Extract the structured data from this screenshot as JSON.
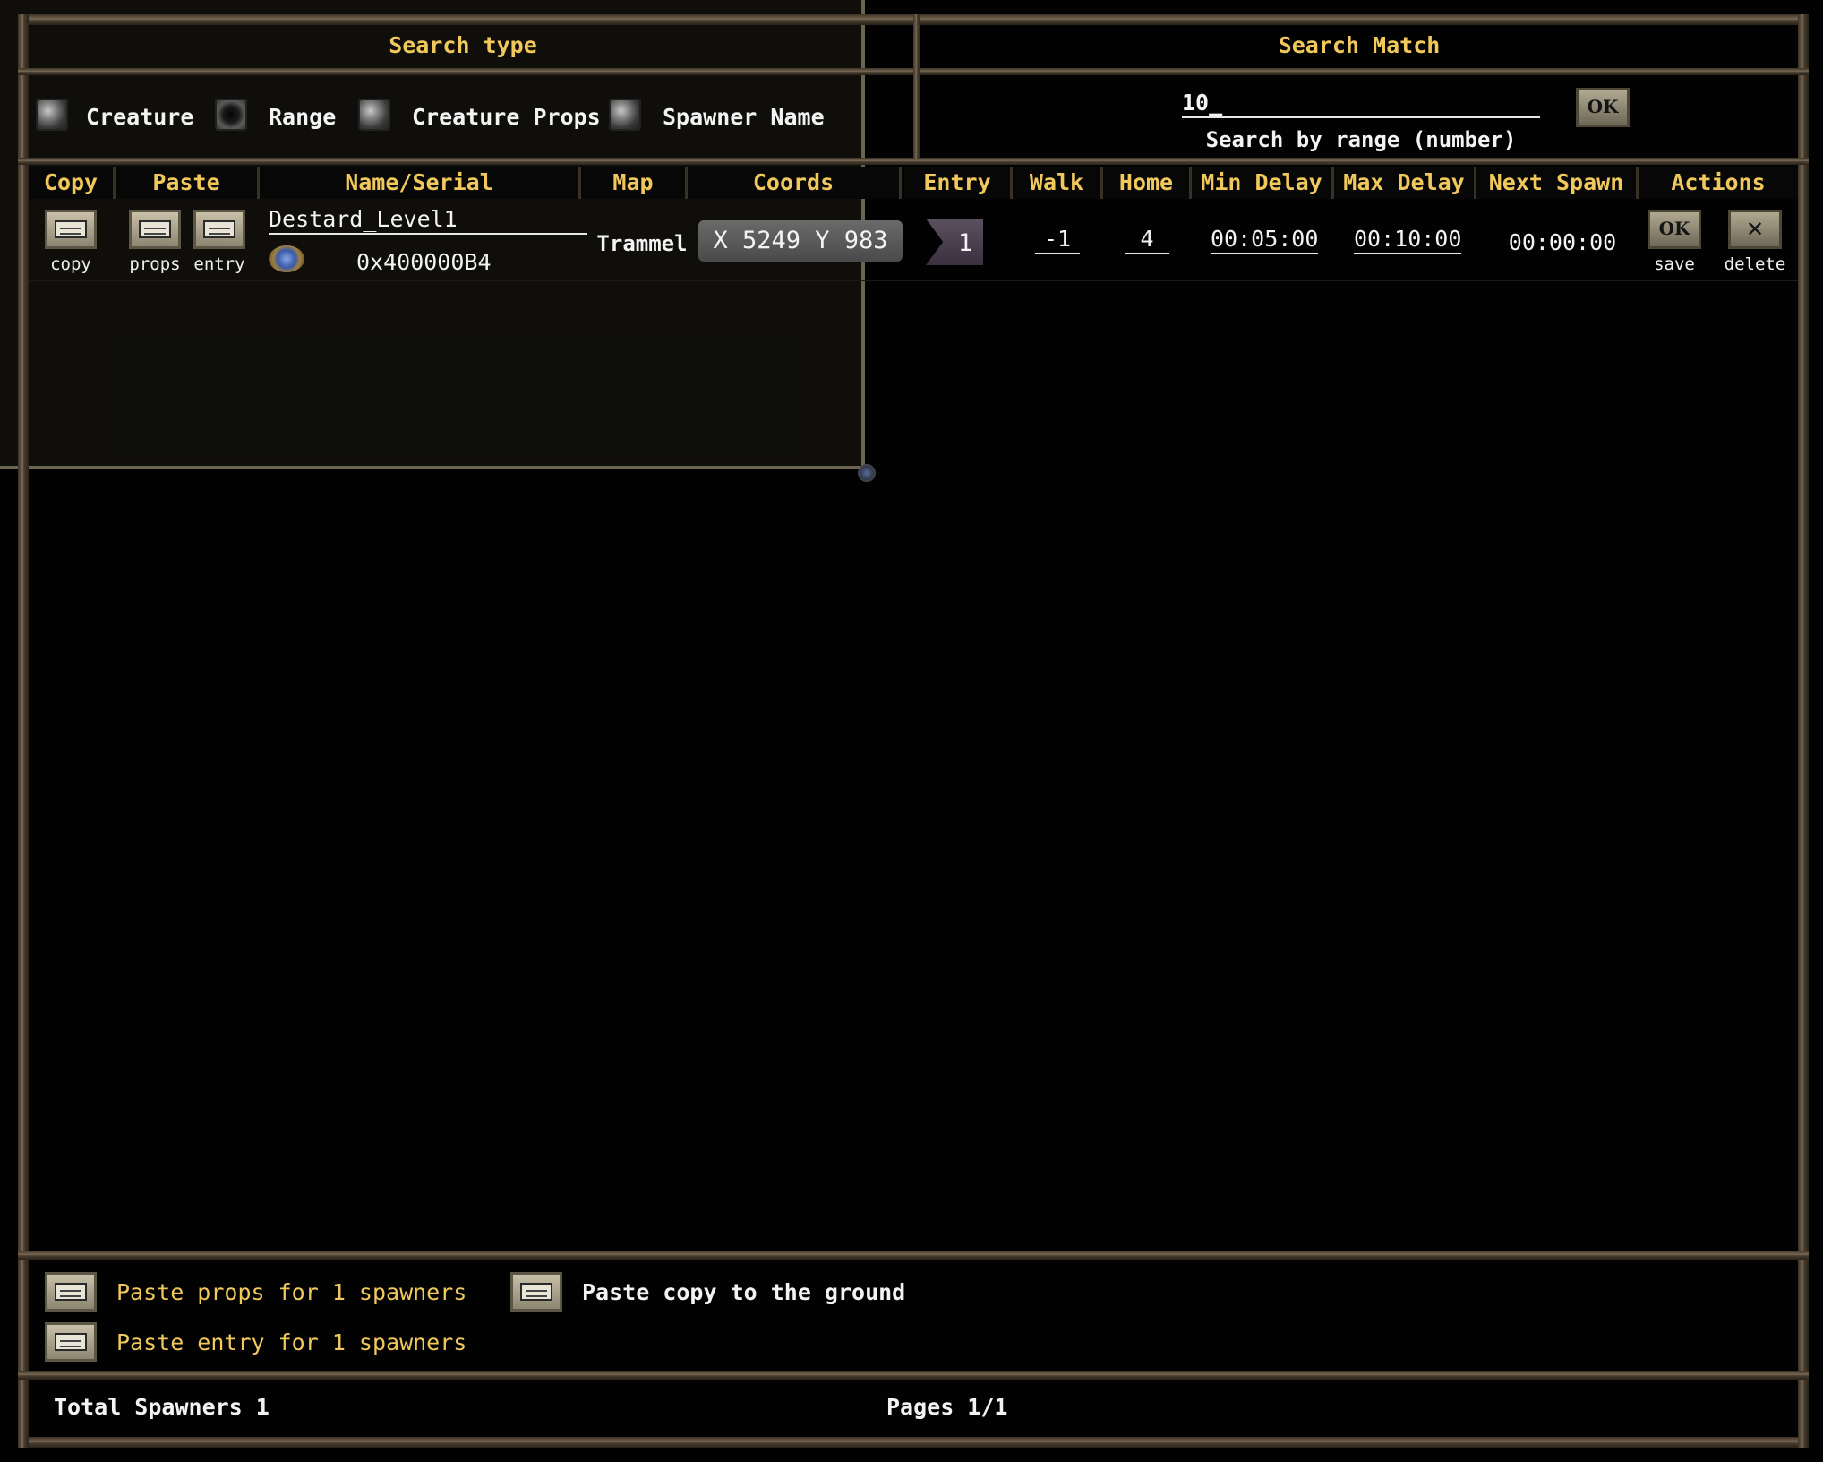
{
  "search_type": {
    "title": "Search type",
    "options": [
      {
        "label": "Creature",
        "selected": false
      },
      {
        "label": "Range",
        "selected": true
      },
      {
        "label": "Creature Props",
        "selected": false
      },
      {
        "label": "Spawner Name",
        "selected": false
      }
    ]
  },
  "search_match": {
    "title": "Search Match",
    "value": "10_",
    "hint": "Search by range (number)",
    "ok_label": "OK"
  },
  "columns": [
    "Copy",
    "Paste",
    "Name/Serial",
    "Map",
    "Coords",
    "Entry",
    "Walk",
    "Home",
    "Min Delay",
    "Max Delay",
    "Next Spawn",
    "Actions"
  ],
  "row": {
    "copy_label": "copy",
    "props_label": "props",
    "entry_label": "entry",
    "name": "Destard_Level1",
    "serial": "0x400000B4",
    "map": "Trammel",
    "coords": "X 5249 Y 983",
    "entry": "1",
    "walk": "-1",
    "home": "4",
    "min_delay": "00:05:00",
    "max_delay": "00:10:00",
    "next_spawn": "00:00:00",
    "save_ok": "OK",
    "save_label": "save",
    "delete_label": "delete"
  },
  "footer": {
    "paste_props": "Paste props for 1 spawners",
    "paste_entry": "Paste entry for 1 spawners",
    "paste_ground": "Paste copy to the ground",
    "total": "Total Spawners 1",
    "pages": "Pages 1/1"
  },
  "colors": {
    "accent_gold": "#f0c85c",
    "frame_bronze": "#7a6a55",
    "background": "#020202"
  }
}
